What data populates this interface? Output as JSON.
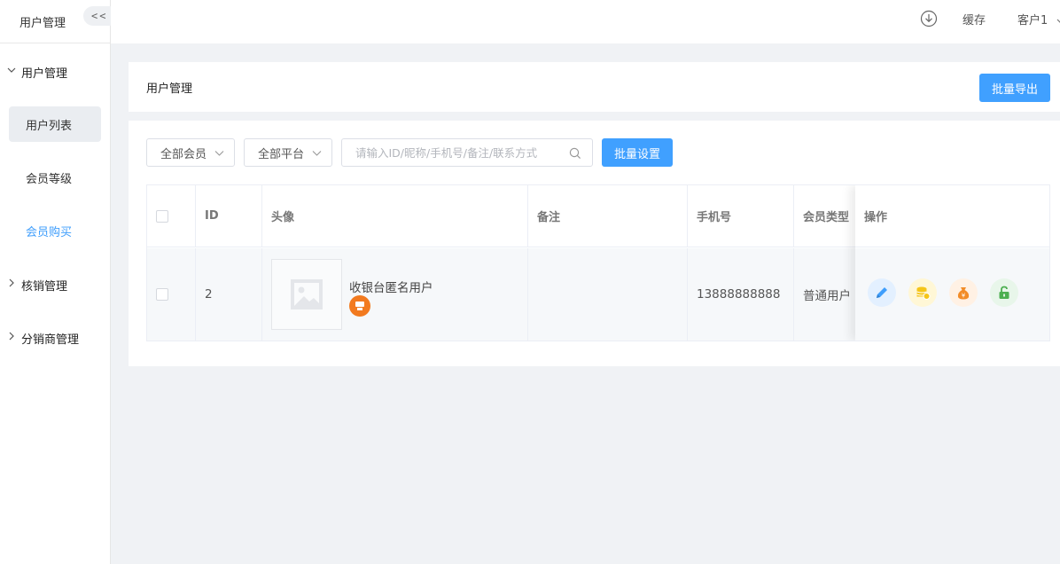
{
  "sidebar": {
    "title": "用户管理",
    "collapse_label": "<<",
    "groups": [
      {
        "label": "用户管理",
        "expanded": true,
        "items": [
          {
            "label": "用户列表",
            "state": "active"
          },
          {
            "label": "会员等级",
            "state": "normal"
          },
          {
            "label": "会员购买",
            "state": "link"
          }
        ]
      },
      {
        "label": "核销管理",
        "expanded": false
      },
      {
        "label": "分销商管理",
        "expanded": false
      }
    ]
  },
  "topbar": {
    "download_icon": "download-icon",
    "cache_label": "缓存",
    "user_label": "客户1"
  },
  "header": {
    "title": "用户管理",
    "export_button": "批量导出"
  },
  "filters": {
    "member_select": "全部会员",
    "platform_select": "全部平台",
    "search_placeholder": "请输入ID/昵称/手机号/备注/联系方式",
    "batch_button": "批量设置"
  },
  "table": {
    "columns": [
      "",
      "ID",
      "头像",
      "备注",
      "手机号",
      "会员类型",
      "操作"
    ],
    "rows": [
      {
        "id": "2",
        "name": "收银台匿名用户",
        "remark": "",
        "phone": "13888888888",
        "member_type": "普通用户"
      }
    ],
    "actions": [
      "edit-icon",
      "coins-icon",
      "money-bag-icon",
      "unlock-icon"
    ]
  },
  "colors": {
    "primary": "#40a0ff",
    "link": "#3f9efc",
    "badge": "#f27a1f"
  }
}
